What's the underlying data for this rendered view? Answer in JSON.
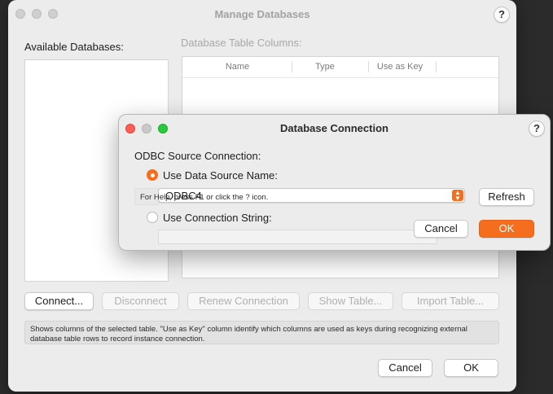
{
  "manage_window": {
    "title": "Manage Databases",
    "help": "?",
    "available_label": "Available Databases:",
    "columns_label": "Database Table Columns:",
    "columns": [
      "Name",
      "Type",
      "Use as Key"
    ],
    "buttons": {
      "connect": "Connect...",
      "disconnect": "Disconnect",
      "renew": "Renew Connection",
      "show_table": "Show Table...",
      "import_table": "Import Table..."
    },
    "info_text": "Shows columns of the selected table. \"Use as Key\" column identify which columns are used as keys during recognizing external database table rows to record instance connection.",
    "cancel": "Cancel",
    "ok": "OK"
  },
  "connection_dialog": {
    "title": "Database Connection",
    "help": "?",
    "section_label": "ODBC Source Connection:",
    "option_dsn": "Use Data Source Name:",
    "dsn_value": "ODBC4",
    "status_hint": "For Help, press F1 or click the ? icon.",
    "refresh": "Refresh",
    "option_conn_string": "Use Connection String:",
    "cancel": "Cancel",
    "ok": "OK"
  },
  "colors": {
    "accent": "#f46e1e",
    "close": "#fd5f57",
    "zoom": "#29c940"
  }
}
